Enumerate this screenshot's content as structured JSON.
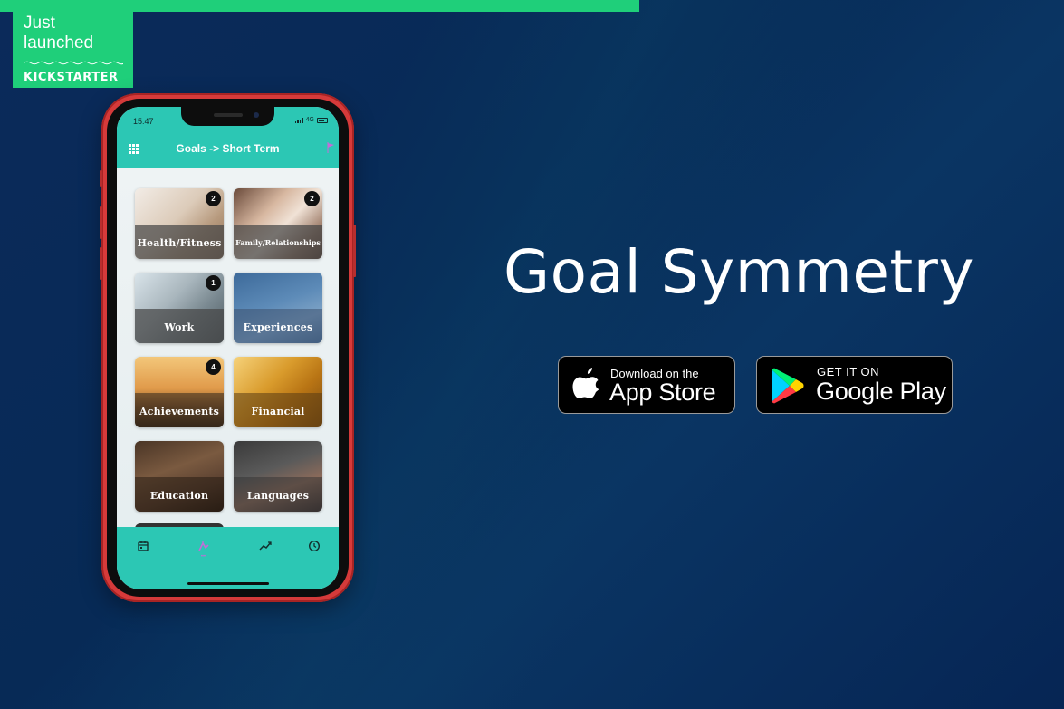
{
  "banner": {
    "line1": "Just",
    "line2": "launched",
    "brand": "KICKSTARTER"
  },
  "phone": {
    "status_time": "15:47",
    "status_network": "4G",
    "header_title": "Goals -> Short Term",
    "tiles": [
      {
        "label": "Health/Fitness",
        "count": "2"
      },
      {
        "label": "Family/Relationships",
        "count": "2"
      },
      {
        "label": "Work",
        "count": "1"
      },
      {
        "label": "Experiences",
        "count": ""
      },
      {
        "label": "Achievements",
        "count": "4"
      },
      {
        "label": "Financial",
        "count": ""
      },
      {
        "label": "Education",
        "count": ""
      },
      {
        "label": "Languages",
        "count": ""
      }
    ],
    "tabs": [
      {
        "icon": "calendar-icon"
      },
      {
        "icon": "goals-icon"
      },
      {
        "icon": "trending-icon"
      },
      {
        "icon": "clock-icon"
      }
    ]
  },
  "hero": {
    "title": "Goal Symmetry"
  },
  "stores": {
    "apple": {
      "small": "Download on the",
      "big": "App Store"
    },
    "google": {
      "small": "GET IT ON",
      "big": "Google Play"
    }
  },
  "colors": {
    "kickstarter_green": "#1fcf7a",
    "app_teal": "#2cc7b4",
    "phone_red": "#d63a3a",
    "background_navy": "#0b2a5a"
  }
}
